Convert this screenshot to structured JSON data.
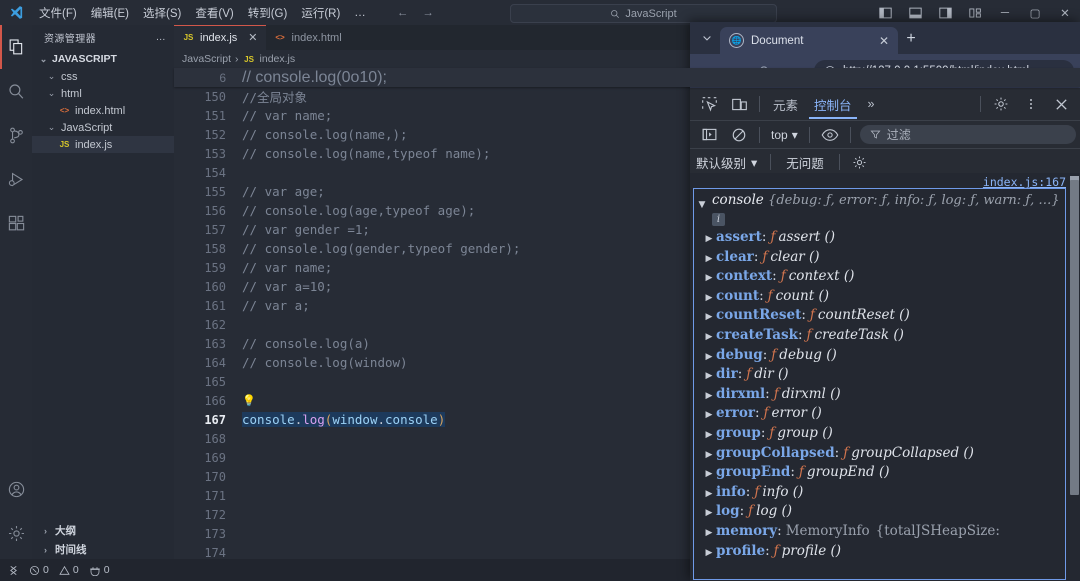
{
  "vscode": {
    "menu": [
      "文件(F)",
      "编辑(E)",
      "选择(S)",
      "查看(V)",
      "转到(G)",
      "运行(R)",
      "…"
    ],
    "nav": {
      "back": "←",
      "forward": "→"
    },
    "search_value": "JavaScript",
    "search_icon": "search-icon",
    "window_controls": {
      "layout_sidebar": "▌▌",
      "layout_panel": "▤",
      "layout_right": "▥",
      "layout_grid": "▦",
      "minimize": "─",
      "maximize": "▢",
      "close": "✕"
    },
    "activitybar": [
      {
        "name": "explorer",
        "glyph": "explorer-icon",
        "active": true
      },
      {
        "name": "search",
        "glyph": "search-icon",
        "active": false
      },
      {
        "name": "source-control",
        "glyph": "branch-icon",
        "active": false
      },
      {
        "name": "run-debug",
        "glyph": "run-debug-icon",
        "active": false
      },
      {
        "name": "extensions",
        "glyph": "extensions-icon",
        "active": false
      }
    ],
    "activitybar_bottom": [
      {
        "name": "accounts",
        "glyph": "account-icon"
      },
      {
        "name": "settings",
        "glyph": "gear-icon"
      }
    ],
    "sidebar": {
      "title": "资源管理器",
      "more": "…",
      "root": "JAVASCRIPT",
      "tree": [
        {
          "label": "css",
          "indent": 1,
          "kind": "folder",
          "expanded": true,
          "selected": false
        },
        {
          "label": "html",
          "indent": 1,
          "kind": "folder",
          "expanded": true,
          "selected": false
        },
        {
          "label": "index.html",
          "indent": 2,
          "kind": "html",
          "expanded": false,
          "selected": false
        },
        {
          "label": "JavaScript",
          "indent": 1,
          "kind": "folder",
          "expanded": true,
          "selected": false
        },
        {
          "label": "index.js",
          "indent": 2,
          "kind": "js",
          "expanded": false,
          "selected": true
        }
      ],
      "footer": [
        {
          "label": "大纲"
        },
        {
          "label": "时间线"
        }
      ]
    },
    "tabs": [
      {
        "label": "index.js",
        "kind": "js",
        "active": true,
        "closable": true
      },
      {
        "label": "index.html",
        "kind": "html",
        "active": false,
        "closable": false
      }
    ],
    "breadcrumb": [
      "JavaScript",
      "index.js"
    ],
    "sticky_line": {
      "number": "6",
      "text": "// console.log(0o10);"
    },
    "lines": [
      {
        "n": "150",
        "text": "//全局对象",
        "style": "comment"
      },
      {
        "n": "151",
        "text": "// var name;",
        "style": "comment"
      },
      {
        "n": "152",
        "text": "// console.log(name,);",
        "style": "comment"
      },
      {
        "n": "153",
        "text": "// console.log(name,typeof name);",
        "style": "comment"
      },
      {
        "n": "154",
        "text": "",
        "style": "comment"
      },
      {
        "n": "155",
        "text": "// var age;",
        "style": "comment"
      },
      {
        "n": "156",
        "text": "// console.log(age,typeof age);",
        "style": "comment"
      },
      {
        "n": "157",
        "text": "// var gender =1;",
        "style": "comment"
      },
      {
        "n": "158",
        "text": "// console.log(gender,typeof gender);",
        "style": "comment"
      },
      {
        "n": "159",
        "text": "// var name;",
        "style": "comment"
      },
      {
        "n": "160",
        "text": "// var a=10;",
        "style": "comment"
      },
      {
        "n": "161",
        "text": "// var a;",
        "style": "comment"
      },
      {
        "n": "162",
        "text": "",
        "style": "comment"
      },
      {
        "n": "163",
        "text": "// console.log(a)",
        "style": "comment"
      },
      {
        "n": "164",
        "text": "// console.log(window)",
        "style": "comment"
      },
      {
        "n": "165",
        "text": "",
        "style": "comment"
      },
      {
        "n": "166",
        "text": "",
        "style": "bulb"
      },
      {
        "n": "167",
        "text": "console.log(window.console)",
        "style": "code-selected",
        "current": true
      },
      {
        "n": "168",
        "text": "",
        "style": "comment"
      },
      {
        "n": "169",
        "text": "",
        "style": "comment"
      },
      {
        "n": "170",
        "text": "",
        "style": "comment"
      },
      {
        "n": "171",
        "text": "",
        "style": "comment"
      },
      {
        "n": "172",
        "text": "",
        "style": "comment"
      },
      {
        "n": "173",
        "text": "",
        "style": "comment"
      },
      {
        "n": "174",
        "text": "",
        "style": "comment"
      }
    ],
    "statusbar": {
      "remote": "remote-icon",
      "errors": "0",
      "warnings": "0",
      "ports": "0"
    }
  },
  "browser": {
    "tab_list_glyph": "chevron-down-icon",
    "tab": {
      "title": "Document",
      "favicon": "globe-icon",
      "close": "✕"
    },
    "new_tab": "+",
    "nav": {
      "back": "←",
      "forward": "→",
      "reload": "⟳",
      "home": "⌂"
    },
    "omnibox": {
      "info_icon": "info-circle-icon",
      "url": "http://127.0.0.1:5500/html/index.html"
    }
  },
  "devtools": {
    "inspect_icon": "inspect-element-icon",
    "device_icon": "device-toolbar-icon",
    "tabs": [
      {
        "label": "元素",
        "active": false
      },
      {
        "label": "控制台",
        "active": true
      }
    ],
    "more_tabs": "»",
    "settings_icon": "gear-icon",
    "kebab_icon": "more-vertical-icon",
    "close_icon": "close-icon",
    "console_toolbar": {
      "sidebar_icon": "console-sidebar-icon",
      "clear_icon": "clear-console-icon",
      "context": "top",
      "context_caret": "▾",
      "eye_icon": "live-expression-icon",
      "filter_icon": "filter-icon",
      "filter_placeholder": "过滤"
    },
    "level_bar": {
      "level": "默认级别",
      "level_caret": "▾",
      "issues": "无问题",
      "settings_icon": "gear-icon"
    },
    "console_output": {
      "source_link": "index.js:167",
      "object_name": "console",
      "object_preview": "{debug: ƒ, error: ƒ, info: ƒ, log: ƒ, warn: ƒ,  …}",
      "info_badge": "i",
      "expanded": true,
      "properties": [
        {
          "name": "assert",
          "kind": "fn",
          "value": "assert ()"
        },
        {
          "name": "clear",
          "kind": "fn",
          "value": "clear ()"
        },
        {
          "name": "context",
          "kind": "fn",
          "value": "context ()"
        },
        {
          "name": "count",
          "kind": "fn",
          "value": "count ()"
        },
        {
          "name": "countReset",
          "kind": "fn",
          "value": "countReset ()"
        },
        {
          "name": "createTask",
          "kind": "fn",
          "value": "createTask ()"
        },
        {
          "name": "debug",
          "kind": "fn",
          "value": "debug ()"
        },
        {
          "name": "dir",
          "kind": "fn",
          "value": "dir ()"
        },
        {
          "name": "dirxml",
          "kind": "fn",
          "value": "dirxml ()"
        },
        {
          "name": "error",
          "kind": "fn",
          "value": "error ()"
        },
        {
          "name": "group",
          "kind": "fn",
          "value": "group ()"
        },
        {
          "name": "groupCollapsed",
          "kind": "fn",
          "value": "groupCollapsed ()"
        },
        {
          "name": "groupEnd",
          "kind": "fn",
          "value": "groupEnd ()"
        },
        {
          "name": "info",
          "kind": "fn",
          "value": "info ()"
        },
        {
          "name": "log",
          "kind": "fn",
          "value": "log ()"
        },
        {
          "name": "memory",
          "kind": "obj",
          "value": "MemoryInfo",
          "extra": "{totalJSHeapSize:"
        },
        {
          "name": "profile",
          "kind": "fn",
          "value": "profile ()"
        }
      ]
    }
  },
  "colors": {
    "vscode_bg": "#272c36",
    "vscode_chrome": "#21252e",
    "accent_red": "#d2574a",
    "devtools_bg": "#242831",
    "devtools_accent": "#8ab4f8",
    "browser_chrome": "#39415a"
  }
}
